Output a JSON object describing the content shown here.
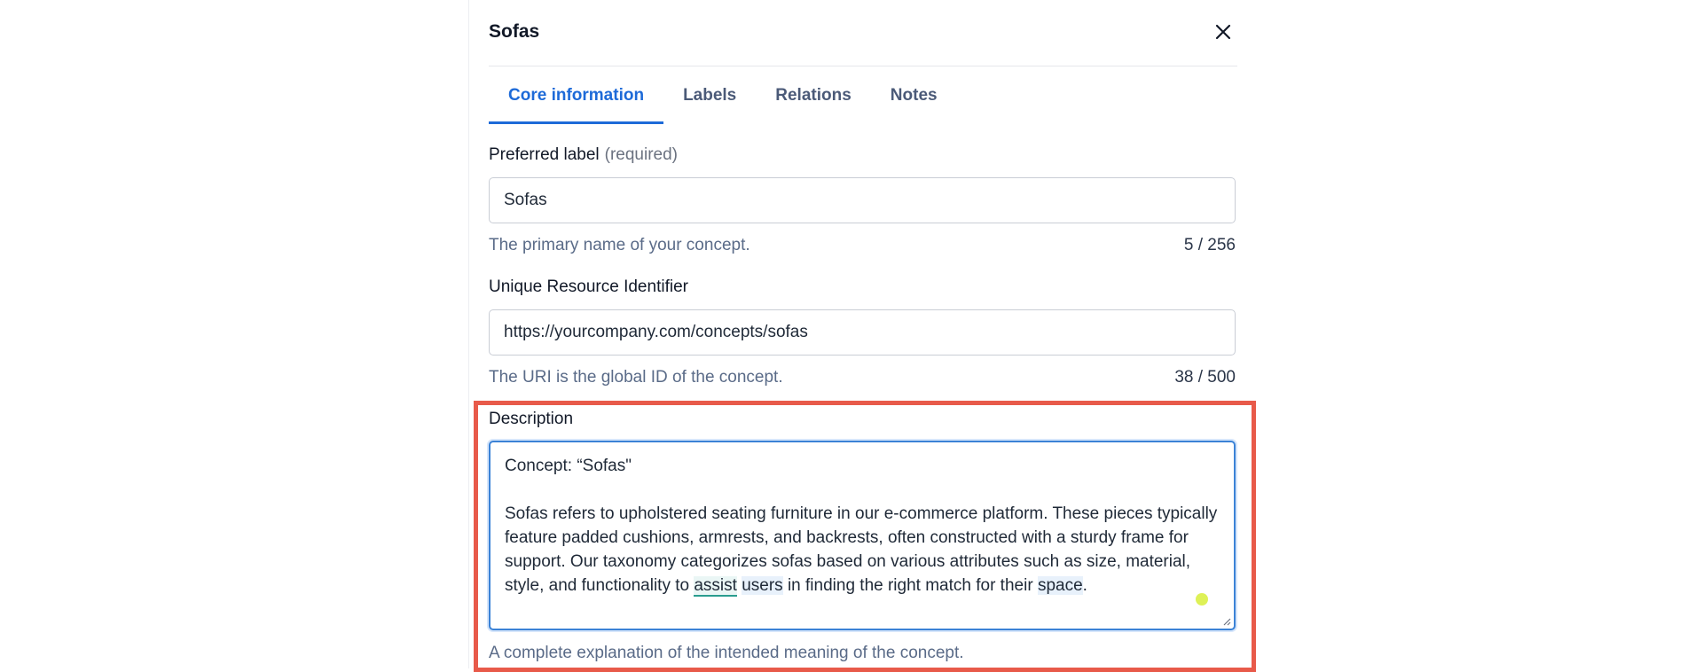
{
  "panel": {
    "title": "Sofas"
  },
  "tabs": [
    {
      "label": "Core information",
      "active": true
    },
    {
      "label": "Labels",
      "active": false
    },
    {
      "label": "Relations",
      "active": false
    },
    {
      "label": "Notes",
      "active": false
    }
  ],
  "preferred_label": {
    "label": "Preferred label",
    "required": "(required)",
    "value": "Sofas",
    "hint": "The primary name of your concept.",
    "counter": "5 / 256"
  },
  "uri": {
    "label": "Unique Resource Identifier",
    "value": "https://yourcompany.com/concepts/sofas",
    "hint": "The URI is the global ID of the concept.",
    "counter": "38 / 500"
  },
  "description": {
    "label": "Description",
    "line1": "Concept: “Sofas\"",
    "para_before": "Sofas refers to upholstered seating furniture in our e-commerce platform. These pieces typically feature padded cushions, armrests, and backrests, often constructed with a sturdy frame for support. Our taxonomy categorizes sofas based on various attributes such as size, material, style, and functionality to ",
    "mark1": "assist",
    "between1": " ",
    "mark2": "users",
    "between2": " in finding the right match for their ",
    "mark3": "space",
    "para_after": ".",
    "hint": "A complete explanation of the intended meaning of the concept."
  },
  "colors": {
    "accent": "#1d6ad8",
    "highlight_border": "#e85a4a",
    "cursor": "#d8ef3a"
  },
  "icons": {
    "close": "close-icon"
  }
}
